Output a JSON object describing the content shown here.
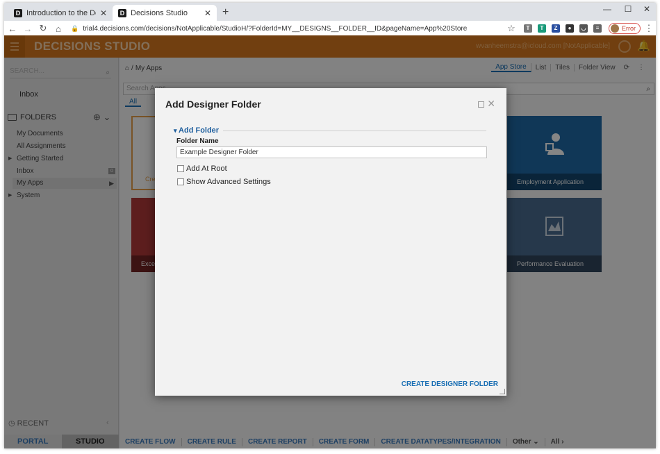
{
  "browser": {
    "tabs": [
      {
        "title": "Introduction to the Decisions Stu",
        "favicon": "D"
      },
      {
        "title": "Decisions Studio",
        "favicon": "D"
      }
    ],
    "url": "trial4.decisions.com/decisions/NotApplicable/StudioH/?FolderId=MY__DESIGNS__FOLDER__ID&pageName=App%20Store",
    "profile_status": "Error"
  },
  "app": {
    "brand": "DECISIONS STUDIO",
    "user": "wvanheemstra@icloud.com [NotApplicable]",
    "accent": "#d97a1f"
  },
  "sidebar": {
    "search_placeholder": "SEARCH...",
    "inbox": "Inbox",
    "folders_title": "FOLDERS",
    "items": [
      {
        "label": "My Documents"
      },
      {
        "label": "All Assignments"
      },
      {
        "label": "Getting Started"
      },
      {
        "label": "Inbox",
        "badge": "0"
      },
      {
        "label": "My Apps"
      },
      {
        "label": "System"
      }
    ],
    "recent": "RECENT",
    "tabs": {
      "portal": "PORTAL",
      "studio": "STUDIO"
    }
  },
  "main": {
    "breadcrumb": "My Apps",
    "views": [
      "App Store",
      "List",
      "Tiles",
      "Folder View"
    ],
    "search_placeholder": "Search Apps",
    "filter_tab": "All",
    "cards": [
      {
        "label": "Cre",
        "kind": "create"
      },
      {
        "label": "Employment Application"
      },
      {
        "label": "Excep"
      },
      {
        "label": "Performance Evaluation"
      }
    ],
    "bottom_actions": [
      "CREATE FLOW",
      "CREATE RULE",
      "CREATE REPORT",
      "CREATE FORM",
      "CREATE DATATYPES/INTEGRATION"
    ],
    "other": "Other",
    "all": "All"
  },
  "modal": {
    "title": "Add Designer Folder",
    "section": "Add Folder",
    "folder_name_label": "Folder Name",
    "folder_name_value": "Example Designer Folder",
    "add_at_root": "Add At Root",
    "show_advanced": "Show Advanced Settings",
    "create_button": "CREATE DESIGNER FOLDER"
  }
}
